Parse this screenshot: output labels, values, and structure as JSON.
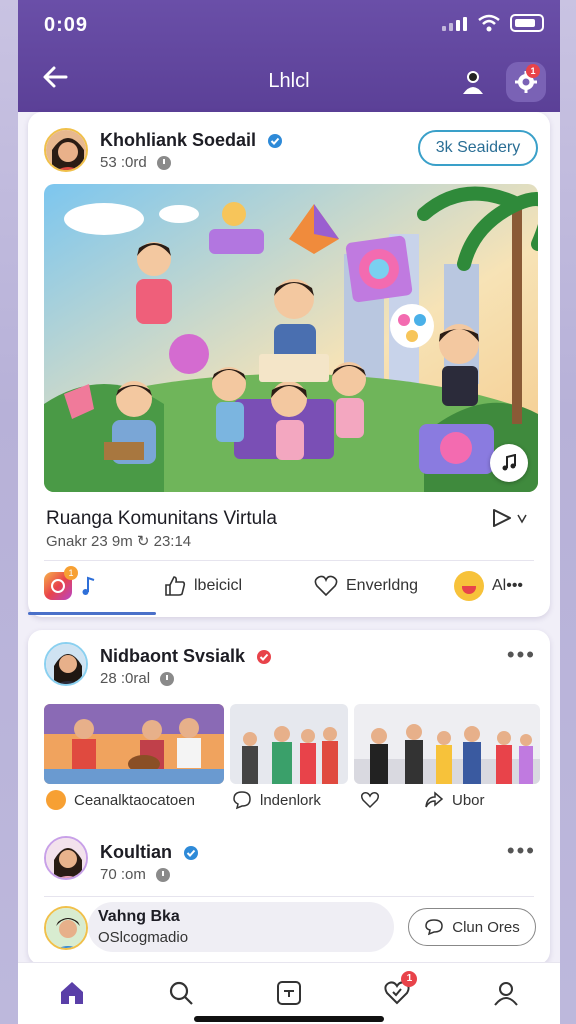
{
  "status_bar": {
    "time": "0:09"
  },
  "header": {
    "title": "Lhlcl",
    "notification_count": "1"
  },
  "post1": {
    "author": "Khohliank Soedail",
    "meta": "53 :0rd",
    "follow_label": "3k Seaidery",
    "title": "Ruanga Komunitans Virtula",
    "stats": "Gnakr  23 9m  ↻ 23:14",
    "actions": {
      "like_label": "lbeicicl",
      "heart_label": "Enverldng",
      "more_label": "Al•••",
      "notif_count": "1"
    }
  },
  "post2": {
    "author": "Nidbaont Svsialk",
    "meta": "28 :0ral",
    "actions": {
      "first_label": "Ceanalktaocatoen",
      "second_label": "lndenlork",
      "third_label": "Ubor"
    }
  },
  "post3": {
    "author": "Koultian",
    "meta": "70 :om"
  },
  "comment": {
    "name": "Vahng Bka",
    "sub": "OSlcogmadio",
    "button_label": "Clun Ores"
  },
  "bottom_nav": {
    "notif_count": "1"
  },
  "colors": {
    "brand": "#5b4097",
    "accent": "#3aa0c9",
    "badge": "#e8434a"
  }
}
